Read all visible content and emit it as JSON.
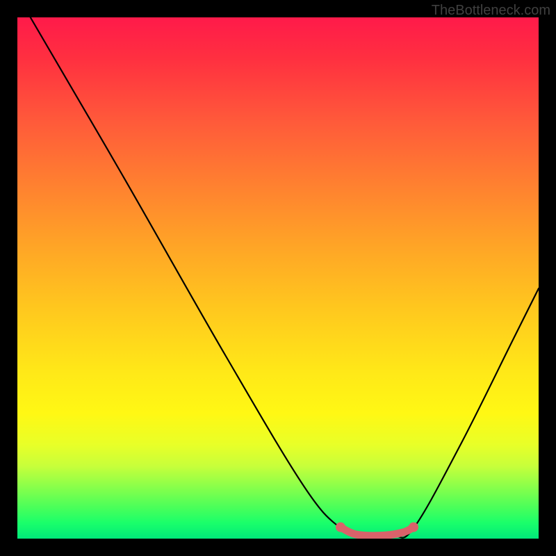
{
  "watermark": "TheBottleneck.com",
  "chart_data": {
    "type": "line",
    "title": "",
    "xlabel": "",
    "ylabel": "",
    "xlim": [
      0,
      100
    ],
    "ylim": [
      0,
      100
    ],
    "background_gradient": {
      "top": "#ff1a4a",
      "mid": "#ffe818",
      "bottom": "#00e87a"
    },
    "series": [
      {
        "name": "bottleneck-curve",
        "color": "#000000",
        "points": [
          {
            "x": 2.5,
            "y": 100
          },
          {
            "x": 20,
            "y": 70
          },
          {
            "x": 40,
            "y": 35
          },
          {
            "x": 55,
            "y": 10
          },
          {
            "x": 62,
            "y": 2
          },
          {
            "x": 66,
            "y": 0.5
          },
          {
            "x": 72,
            "y": 0.5
          },
          {
            "x": 76,
            "y": 2
          },
          {
            "x": 85,
            "y": 18
          },
          {
            "x": 95,
            "y": 38
          },
          {
            "x": 100,
            "y": 48
          }
        ]
      },
      {
        "name": "optimal-range-marker",
        "color": "#d9626a",
        "points": [
          {
            "x": 62,
            "y": 2.2
          },
          {
            "x": 65,
            "y": 0.8
          },
          {
            "x": 70,
            "y": 0.6
          },
          {
            "x": 74,
            "y": 1.2
          },
          {
            "x": 76,
            "y": 2.2
          }
        ]
      }
    ]
  }
}
